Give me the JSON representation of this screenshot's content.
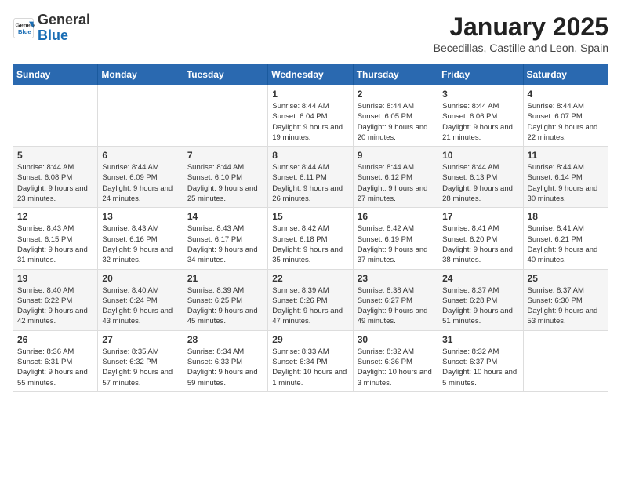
{
  "header": {
    "logo_general": "General",
    "logo_blue": "Blue",
    "month_title": "January 2025",
    "location": "Becedillas, Castille and Leon, Spain"
  },
  "weekdays": [
    "Sunday",
    "Monday",
    "Tuesday",
    "Wednesday",
    "Thursday",
    "Friday",
    "Saturday"
  ],
  "weeks": [
    [
      {
        "day": "",
        "info": ""
      },
      {
        "day": "",
        "info": ""
      },
      {
        "day": "",
        "info": ""
      },
      {
        "day": "1",
        "info": "Sunrise: 8:44 AM\nSunset: 6:04 PM\nDaylight: 9 hours\nand 19 minutes."
      },
      {
        "day": "2",
        "info": "Sunrise: 8:44 AM\nSunset: 6:05 PM\nDaylight: 9 hours\nand 20 minutes."
      },
      {
        "day": "3",
        "info": "Sunrise: 8:44 AM\nSunset: 6:06 PM\nDaylight: 9 hours\nand 21 minutes."
      },
      {
        "day": "4",
        "info": "Sunrise: 8:44 AM\nSunset: 6:07 PM\nDaylight: 9 hours\nand 22 minutes."
      }
    ],
    [
      {
        "day": "5",
        "info": "Sunrise: 8:44 AM\nSunset: 6:08 PM\nDaylight: 9 hours\nand 23 minutes."
      },
      {
        "day": "6",
        "info": "Sunrise: 8:44 AM\nSunset: 6:09 PM\nDaylight: 9 hours\nand 24 minutes."
      },
      {
        "day": "7",
        "info": "Sunrise: 8:44 AM\nSunset: 6:10 PM\nDaylight: 9 hours\nand 25 minutes."
      },
      {
        "day": "8",
        "info": "Sunrise: 8:44 AM\nSunset: 6:11 PM\nDaylight: 9 hours\nand 26 minutes."
      },
      {
        "day": "9",
        "info": "Sunrise: 8:44 AM\nSunset: 6:12 PM\nDaylight: 9 hours\nand 27 minutes."
      },
      {
        "day": "10",
        "info": "Sunrise: 8:44 AM\nSunset: 6:13 PM\nDaylight: 9 hours\nand 28 minutes."
      },
      {
        "day": "11",
        "info": "Sunrise: 8:44 AM\nSunset: 6:14 PM\nDaylight: 9 hours\nand 30 minutes."
      }
    ],
    [
      {
        "day": "12",
        "info": "Sunrise: 8:43 AM\nSunset: 6:15 PM\nDaylight: 9 hours\nand 31 minutes."
      },
      {
        "day": "13",
        "info": "Sunrise: 8:43 AM\nSunset: 6:16 PM\nDaylight: 9 hours\nand 32 minutes."
      },
      {
        "day": "14",
        "info": "Sunrise: 8:43 AM\nSunset: 6:17 PM\nDaylight: 9 hours\nand 34 minutes."
      },
      {
        "day": "15",
        "info": "Sunrise: 8:42 AM\nSunset: 6:18 PM\nDaylight: 9 hours\nand 35 minutes."
      },
      {
        "day": "16",
        "info": "Sunrise: 8:42 AM\nSunset: 6:19 PM\nDaylight: 9 hours\nand 37 minutes."
      },
      {
        "day": "17",
        "info": "Sunrise: 8:41 AM\nSunset: 6:20 PM\nDaylight: 9 hours\nand 38 minutes."
      },
      {
        "day": "18",
        "info": "Sunrise: 8:41 AM\nSunset: 6:21 PM\nDaylight: 9 hours\nand 40 minutes."
      }
    ],
    [
      {
        "day": "19",
        "info": "Sunrise: 8:40 AM\nSunset: 6:22 PM\nDaylight: 9 hours\nand 42 minutes."
      },
      {
        "day": "20",
        "info": "Sunrise: 8:40 AM\nSunset: 6:24 PM\nDaylight: 9 hours\nand 43 minutes."
      },
      {
        "day": "21",
        "info": "Sunrise: 8:39 AM\nSunset: 6:25 PM\nDaylight: 9 hours\nand 45 minutes."
      },
      {
        "day": "22",
        "info": "Sunrise: 8:39 AM\nSunset: 6:26 PM\nDaylight: 9 hours\nand 47 minutes."
      },
      {
        "day": "23",
        "info": "Sunrise: 8:38 AM\nSunset: 6:27 PM\nDaylight: 9 hours\nand 49 minutes."
      },
      {
        "day": "24",
        "info": "Sunrise: 8:37 AM\nSunset: 6:28 PM\nDaylight: 9 hours\nand 51 minutes."
      },
      {
        "day": "25",
        "info": "Sunrise: 8:37 AM\nSunset: 6:30 PM\nDaylight: 9 hours\nand 53 minutes."
      }
    ],
    [
      {
        "day": "26",
        "info": "Sunrise: 8:36 AM\nSunset: 6:31 PM\nDaylight: 9 hours\nand 55 minutes."
      },
      {
        "day": "27",
        "info": "Sunrise: 8:35 AM\nSunset: 6:32 PM\nDaylight: 9 hours\nand 57 minutes."
      },
      {
        "day": "28",
        "info": "Sunrise: 8:34 AM\nSunset: 6:33 PM\nDaylight: 9 hours\nand 59 minutes."
      },
      {
        "day": "29",
        "info": "Sunrise: 8:33 AM\nSunset: 6:34 PM\nDaylight: 10 hours\nand 1 minute."
      },
      {
        "day": "30",
        "info": "Sunrise: 8:32 AM\nSunset: 6:36 PM\nDaylight: 10 hours\nand 3 minutes."
      },
      {
        "day": "31",
        "info": "Sunrise: 8:32 AM\nSunset: 6:37 PM\nDaylight: 10 hours\nand 5 minutes."
      },
      {
        "day": "",
        "info": ""
      }
    ]
  ]
}
